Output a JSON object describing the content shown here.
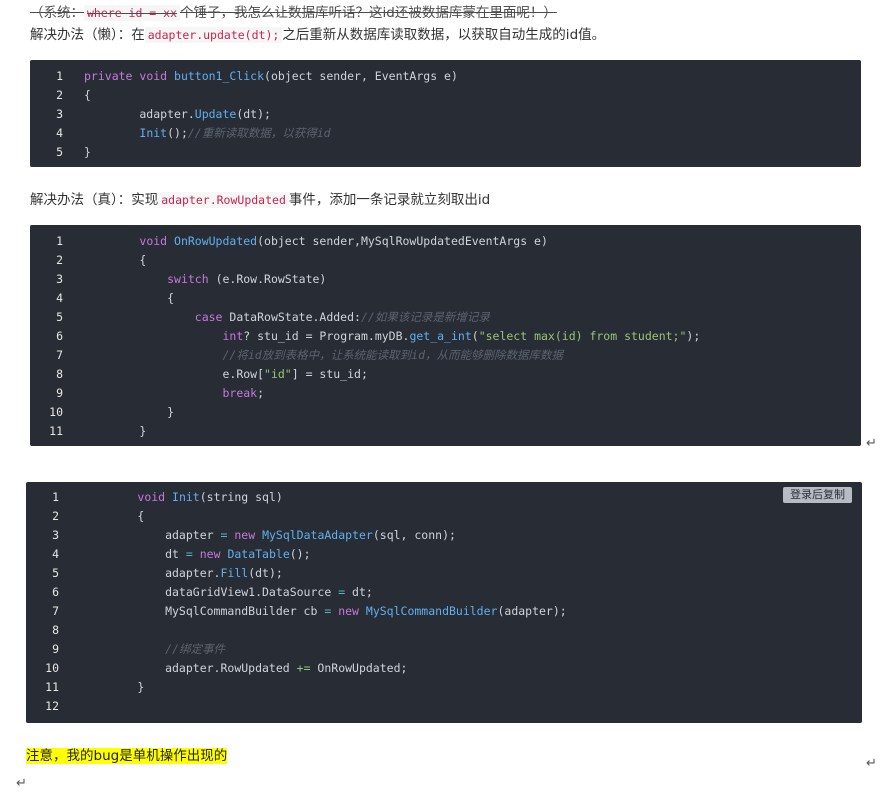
{
  "intro": {
    "strike_prefix": "（系统：",
    "strike_code": "where id = xx",
    "strike_suffix": "个锤子，我怎么让数据库听话？这id还被数据库蒙在里面呢！）"
  },
  "lazy": {
    "prefix": "解决办法（懒）：在",
    "code": "adapter.update(dt);",
    "suffix": "之后重新从数据库读取数据，以获取自动生成的id值。"
  },
  "block1": {
    "lines": [
      {
        "n": "1",
        "tokens": [
          [
            "kw",
            "private "
          ],
          [
            "kw",
            "void "
          ],
          [
            "fn",
            "button1_Click"
          ],
          [
            "",
            "(object sender, EventArgs e)"
          ]
        ]
      },
      {
        "n": "2",
        "tokens": [
          [
            "",
            "{"
          ]
        ]
      },
      {
        "n": "3",
        "tokens": [
          [
            "",
            "        adapter."
          ],
          [
            "fn",
            "Update"
          ],
          [
            "",
            "(dt);"
          ]
        ]
      },
      {
        "n": "4",
        "tokens": [
          [
            "",
            "        "
          ],
          [
            "fn",
            "Init"
          ],
          [
            "",
            "();"
          ],
          [
            "cm",
            "//重新读取数据，以获得id"
          ]
        ]
      },
      {
        "n": "5",
        "tokens": [
          [
            "",
            "}"
          ]
        ]
      }
    ]
  },
  "real": {
    "prefix": "解决办法（真）：实现",
    "code": "adapter.RowUpdated",
    "suffix": "事件，添加一条记录就立刻取出id"
  },
  "block2": {
    "lines": [
      {
        "n": "1",
        "tokens": [
          [
            "",
            "        "
          ],
          [
            "kw",
            "void "
          ],
          [
            "fn",
            "OnRowUpdated"
          ],
          [
            "",
            "(object sender,MySqlRowUpdatedEventArgs e)"
          ]
        ]
      },
      {
        "n": "2",
        "tokens": [
          [
            "",
            "        {"
          ]
        ]
      },
      {
        "n": "3",
        "tokens": [
          [
            "",
            "            "
          ],
          [
            "kw",
            "switch"
          ],
          [
            "",
            " (e.Row.RowState)"
          ]
        ]
      },
      {
        "n": "4",
        "tokens": [
          [
            "",
            "            {"
          ]
        ]
      },
      {
        "n": "5",
        "tokens": [
          [
            "",
            "                "
          ],
          [
            "kw",
            "case"
          ],
          [
            "",
            " DataRowState.Added:"
          ],
          [
            "cm",
            "//如果该记录是新增记录"
          ]
        ]
      },
      {
        "n": "6",
        "tokens": [
          [
            "",
            "                    "
          ],
          [
            "kw",
            "int"
          ],
          [
            "",
            "? stu_id = Program.myDB."
          ],
          [
            "fn",
            "get_a_int"
          ],
          [
            "",
            "("
          ],
          [
            "str",
            "\"select max(id) from student;\""
          ],
          [
            "",
            ");"
          ]
        ]
      },
      {
        "n": "7",
        "tokens": [
          [
            "",
            "                    "
          ],
          [
            "cm",
            "//将id放到表格中，让系统能读取到id，从而能够删除数据库数据"
          ]
        ]
      },
      {
        "n": "8",
        "tokens": [
          [
            "",
            "                    e.Row["
          ],
          [
            "str",
            "\"id\""
          ],
          [
            "",
            "] = stu_id;"
          ]
        ]
      },
      {
        "n": "9",
        "tokens": [
          [
            "",
            "                    "
          ],
          [
            "kw",
            "break"
          ],
          [
            "",
            ";"
          ]
        ]
      },
      {
        "n": "10",
        "tokens": [
          [
            "",
            "            }"
          ]
        ]
      },
      {
        "n": "11",
        "tokens": [
          [
            "",
            "        }"
          ]
        ]
      }
    ]
  },
  "block3": {
    "copy_label": "登录后复制",
    "lines": [
      {
        "n": "1",
        "tokens": [
          [
            "",
            "        "
          ],
          [
            "kw",
            "void "
          ],
          [
            "fn",
            "Init"
          ],
          [
            "",
            "(string sql)"
          ]
        ]
      },
      {
        "n": "2",
        "tokens": [
          [
            "",
            "        {"
          ]
        ]
      },
      {
        "n": "3",
        "tokens": [
          [
            "",
            "            adapter "
          ],
          [
            "op",
            "="
          ],
          [
            "",
            " "
          ],
          [
            "kw",
            "new "
          ],
          [
            "fn",
            "MySqlDataAdapter"
          ],
          [
            "",
            "(sql, conn);"
          ]
        ]
      },
      {
        "n": "4",
        "tokens": [
          [
            "",
            "            dt "
          ],
          [
            "op",
            "="
          ],
          [
            "",
            " "
          ],
          [
            "kw",
            "new "
          ],
          [
            "fn",
            "DataTable"
          ],
          [
            "",
            "();"
          ]
        ]
      },
      {
        "n": "5",
        "tokens": [
          [
            "",
            "            adapter."
          ],
          [
            "fn",
            "Fill"
          ],
          [
            "",
            "(dt);"
          ]
        ]
      },
      {
        "n": "6",
        "tokens": [
          [
            "",
            "            dataGridView1.DataSource "
          ],
          [
            "op",
            "="
          ],
          [
            "",
            " dt;"
          ]
        ]
      },
      {
        "n": "7",
        "tokens": [
          [
            "",
            "            MySqlCommandBuilder cb "
          ],
          [
            "op",
            "="
          ],
          [
            "",
            " "
          ],
          [
            "kw",
            "new "
          ],
          [
            "fn",
            "MySqlCommandBuilder"
          ],
          [
            "",
            "(adapter);"
          ]
        ]
      },
      {
        "n": "8",
        "tokens": [
          [
            "",
            ""
          ]
        ]
      },
      {
        "n": "9",
        "tokens": [
          [
            "",
            "            "
          ],
          [
            "cm",
            "//绑定事件"
          ]
        ]
      },
      {
        "n": "10",
        "tokens": [
          [
            "",
            "            adapter.RowUpdated "
          ],
          [
            "str",
            "+="
          ],
          [
            "",
            " OnRowUpdated;"
          ]
        ]
      },
      {
        "n": "11",
        "tokens": [
          [
            "",
            "        }"
          ]
        ]
      },
      {
        "n": "12",
        "tokens": [
          [
            "",
            ""
          ]
        ]
      }
    ]
  },
  "note": {
    "text": "注意，我的bug是单机操作出现的"
  },
  "return_mark": "↵"
}
